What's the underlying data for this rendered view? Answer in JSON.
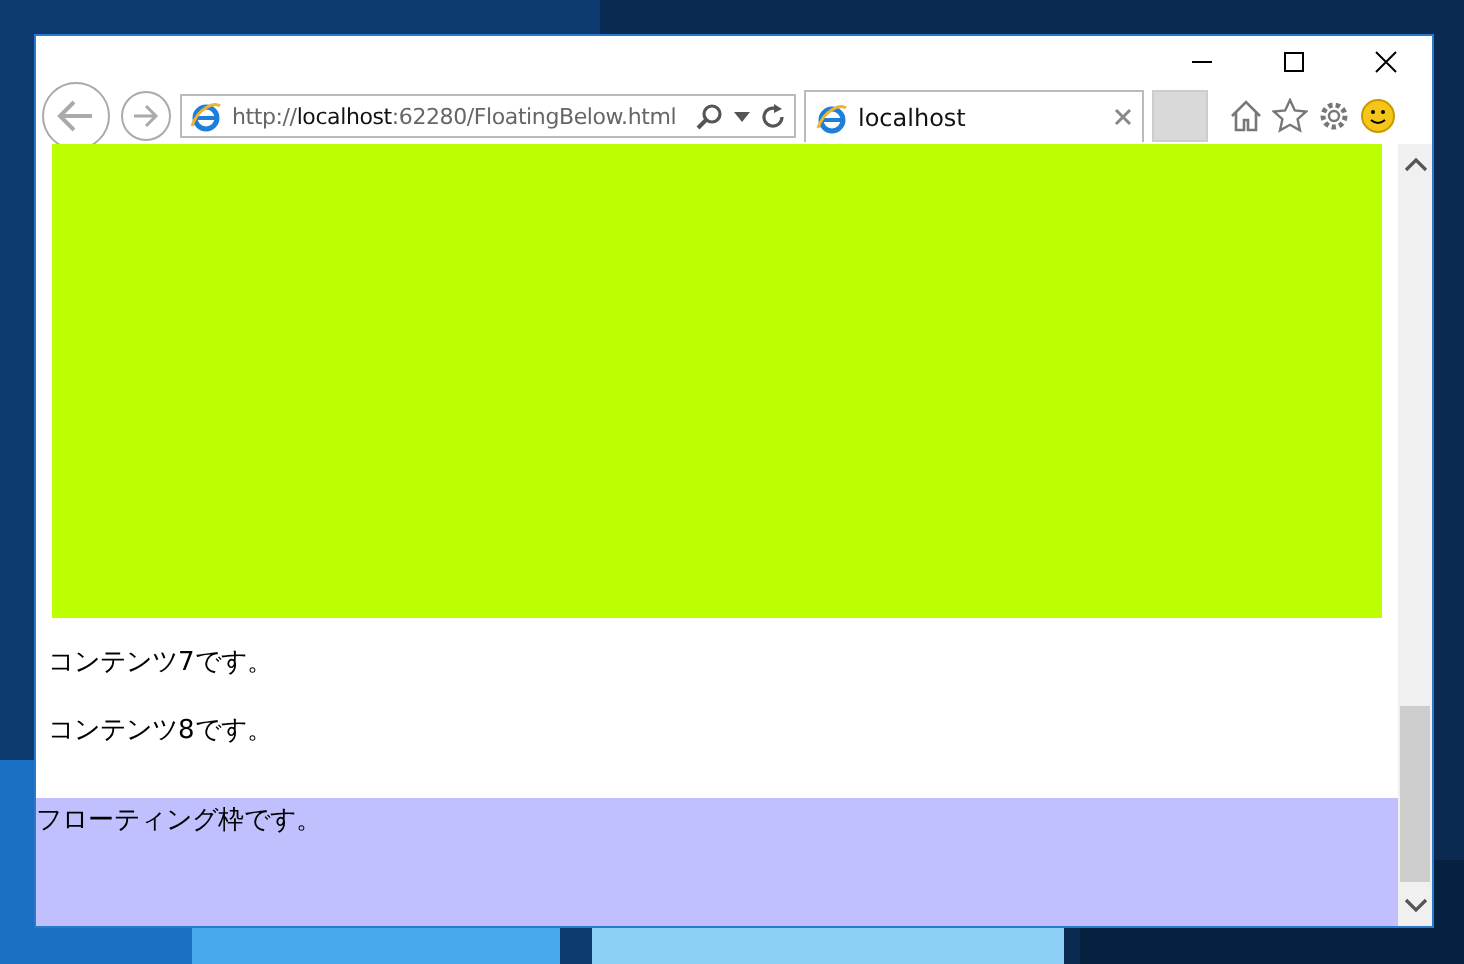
{
  "address_bar": {
    "url_prefix": "http://",
    "url_host": "localhost",
    "url_rest": ":62280/FloatingBelow.html"
  },
  "tabs": [
    {
      "label": "localhost",
      "selected": true
    }
  ],
  "content": {
    "paragraphs": [
      "コンテンツ7です。",
      "コンテンツ8です。"
    ]
  },
  "floating_panel": {
    "text": "フローティング枠です。"
  }
}
